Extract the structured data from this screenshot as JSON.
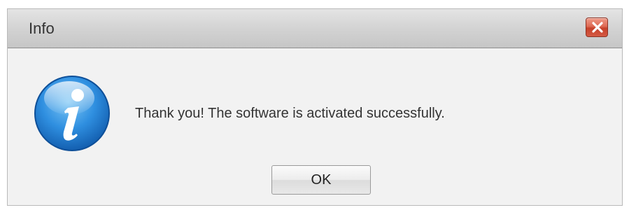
{
  "dialog": {
    "title": "Info",
    "close_icon": "close-icon",
    "message": "Thank you! The software is activated successfully.",
    "icon": "info-icon",
    "ok_label": "OK"
  },
  "colors": {
    "close_button": "#d45a43",
    "info_icon_blue": "#1f7fd0",
    "titlebar": "#d3d3d3",
    "dialog_background": "#f2f2f2"
  }
}
